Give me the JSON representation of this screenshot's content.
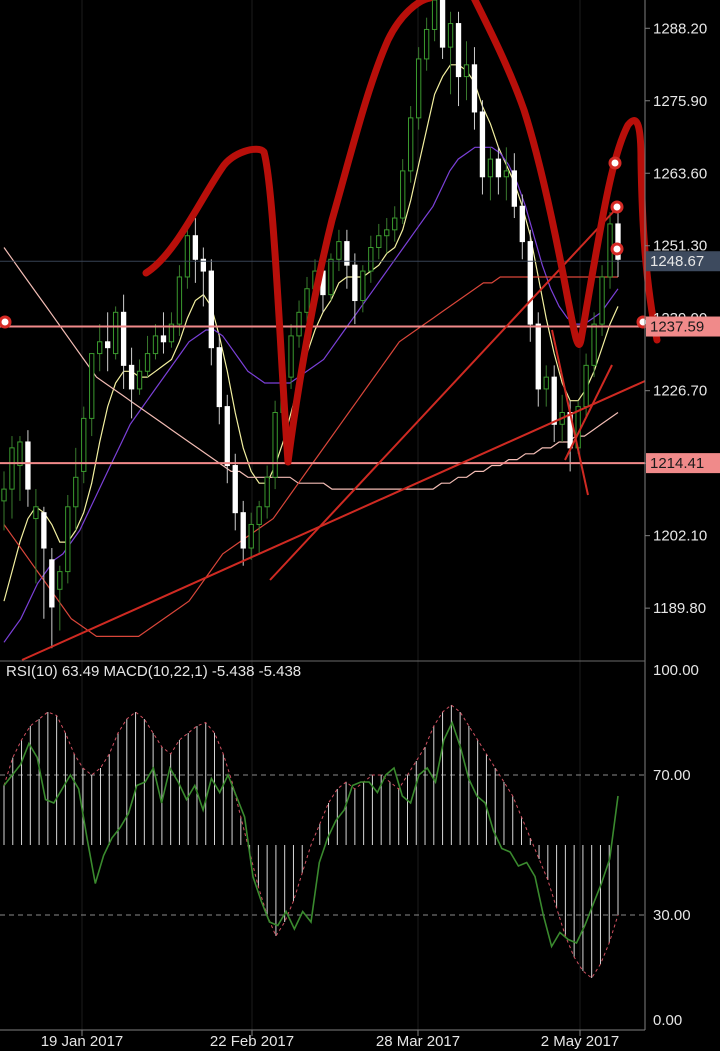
{
  "chart_data": {
    "type": "candlestick",
    "x_ticks": [
      "19 Jan 2017",
      "22 Feb 2017",
      "28 Mar 2017",
      "2 May 2017"
    ],
    "price_axis": {
      "ticks": [
        "1288.20",
        "1275.90",
        "1263.60",
        "1251.30",
        "1239.00",
        "1226.70",
        "1214.40",
        "1202.10",
        "1189.80"
      ],
      "ylim": [
        1181,
        1293
      ]
    },
    "price_tags": [
      {
        "label": "1248.67",
        "value": 1248.67,
        "color": "#3d4a5e"
      },
      {
        "label": "1237.59",
        "value": 1237.59,
        "color": "#f08a8a"
      },
      {
        "label": "1214.41",
        "value": 1214.41,
        "color": "#f08a8a"
      }
    ],
    "candles": [
      {
        "o": 1208,
        "h": 1213,
        "c": 1210,
        "l": 1203
      },
      {
        "o": 1210,
        "h": 1219,
        "c": 1217,
        "l": 1205
      },
      {
        "o": 1214,
        "h": 1219,
        "c": 1218,
        "l": 1208
      },
      {
        "o": 1218,
        "h": 1220,
        "c": 1210,
        "l": 1207
      },
      {
        "o": 1205,
        "h": 1210,
        "c": 1207,
        "l": 1194
      },
      {
        "o": 1206,
        "h": 1207,
        "c": 1200,
        "l": 1188
      },
      {
        "o": 1198,
        "h": 1200,
        "c": 1190,
        "l": 1183
      },
      {
        "o": 1193,
        "h": 1197,
        "c": 1196,
        "l": 1186
      },
      {
        "o": 1196,
        "h": 1209,
        "c": 1207,
        "l": 1194
      },
      {
        "o": 1207,
        "h": 1217,
        "c": 1212,
        "l": 1203
      },
      {
        "o": 1213,
        "h": 1224,
        "c": 1222,
        "l": 1211
      },
      {
        "o": 1222,
        "h": 1232,
        "c": 1233,
        "l": 1219
      },
      {
        "o": 1233,
        "h": 1238,
        "c": 1235,
        "l": 1230
      },
      {
        "o": 1235,
        "h": 1240,
        "c": 1234,
        "l": 1230
      },
      {
        "o": 1233,
        "h": 1241,
        "c": 1240,
        "l": 1232
      },
      {
        "o": 1240,
        "h": 1243,
        "c": 1231,
        "l": 1227
      },
      {
        "o": 1231,
        "h": 1234,
        "c": 1227,
        "l": 1222
      },
      {
        "o": 1227,
        "h": 1232,
        "c": 1230,
        "l": 1226
      },
      {
        "o": 1230,
        "h": 1236,
        "c": 1233,
        "l": 1229
      },
      {
        "o": 1233,
        "h": 1238,
        "c": 1236,
        "l": 1232
      },
      {
        "o": 1236,
        "h": 1240,
        "c": 1235,
        "l": 1233
      },
      {
        "o": 1235,
        "h": 1240,
        "c": 1238,
        "l": 1234
      },
      {
        "o": 1238,
        "h": 1248,
        "c": 1246,
        "l": 1236
      },
      {
        "o": 1246,
        "h": 1255,
        "c": 1253,
        "l": 1244
      },
      {
        "o": 1253,
        "h": 1256,
        "c": 1249,
        "l": 1245
      },
      {
        "o": 1249,
        "h": 1251,
        "c": 1247,
        "l": 1241
      },
      {
        "o": 1247,
        "h": 1249,
        "c": 1234,
        "l": 1231
      },
      {
        "o": 1234,
        "h": 1236,
        "c": 1224,
        "l": 1221
      },
      {
        "o": 1224,
        "h": 1226,
        "c": 1214,
        "l": 1211
      },
      {
        "o": 1214,
        "h": 1216,
        "c": 1206,
        "l": 1203
      },
      {
        "o": 1206,
        "h": 1208,
        "c": 1200,
        "l": 1197
      },
      {
        "o": 1200,
        "h": 1206,
        "c": 1204,
        "l": 1198
      },
      {
        "o": 1204,
        "h": 1208,
        "c": 1207,
        "l": 1199
      },
      {
        "o": 1207,
        "h": 1214,
        "c": 1212,
        "l": 1205
      },
      {
        "o": 1212,
        "h": 1225,
        "c": 1223,
        "l": 1210
      },
      {
        "o": 1223,
        "h": 1231,
        "c": 1229,
        "l": 1221
      },
      {
        "o": 1229,
        "h": 1238,
        "c": 1236,
        "l": 1227
      },
      {
        "o": 1236,
        "h": 1242,
        "c": 1240,
        "l": 1234
      },
      {
        "o": 1240,
        "h": 1246,
        "c": 1244,
        "l": 1238
      },
      {
        "o": 1244,
        "h": 1249,
        "c": 1247,
        "l": 1242
      },
      {
        "o": 1247,
        "h": 1249,
        "c": 1243,
        "l": 1240
      },
      {
        "o": 1243,
        "h": 1250,
        "c": 1249,
        "l": 1242
      },
      {
        "o": 1249,
        "h": 1254,
        "c": 1252,
        "l": 1247
      },
      {
        "o": 1252,
        "h": 1254,
        "c": 1248,
        "l": 1244
      },
      {
        "o": 1248,
        "h": 1250,
        "c": 1242,
        "l": 1238
      },
      {
        "o": 1242,
        "h": 1248,
        "c": 1247,
        "l": 1240
      },
      {
        "o": 1247,
        "h": 1253,
        "c": 1251,
        "l": 1245
      },
      {
        "o": 1251,
        "h": 1255,
        "c": 1253,
        "l": 1249
      },
      {
        "o": 1253,
        "h": 1256,
        "c": 1254,
        "l": 1250
      },
      {
        "o": 1254,
        "h": 1258,
        "c": 1256,
        "l": 1252
      },
      {
        "o": 1256,
        "h": 1266,
        "c": 1264,
        "l": 1255
      },
      {
        "o": 1264,
        "h": 1275,
        "c": 1273,
        "l": 1262
      },
      {
        "o": 1273,
        "h": 1285,
        "c": 1283,
        "l": 1271
      },
      {
        "o": 1283,
        "h": 1290,
        "c": 1288,
        "l": 1281
      },
      {
        "o": 1288,
        "h": 1294,
        "c": 1293,
        "l": 1286
      },
      {
        "o": 1293,
        "h": 1295,
        "c": 1285,
        "l": 1283
      },
      {
        "o": 1285,
        "h": 1291,
        "c": 1289,
        "l": 1277
      },
      {
        "o": 1289,
        "h": 1291,
        "c": 1280,
        "l": 1275
      },
      {
        "o": 1280,
        "h": 1286,
        "c": 1282,
        "l": 1276
      },
      {
        "o": 1282,
        "h": 1285,
        "c": 1274,
        "l": 1271
      },
      {
        "o": 1274,
        "h": 1276,
        "c": 1263,
        "l": 1260
      },
      {
        "o": 1263,
        "h": 1268,
        "c": 1266,
        "l": 1259
      },
      {
        "o": 1266,
        "h": 1268,
        "c": 1263,
        "l": 1260
      },
      {
        "o": 1263,
        "h": 1268,
        "c": 1264,
        "l": 1259
      },
      {
        "o": 1264,
        "h": 1267,
        "c": 1258,
        "l": 1256
      },
      {
        "o": 1258,
        "h": 1260,
        "c": 1252,
        "l": 1249
      },
      {
        "o": 1252,
        "h": 1254,
        "c": 1238,
        "l": 1235
      },
      {
        "o": 1238,
        "h": 1240,
        "c": 1227,
        "l": 1224
      },
      {
        "o": 1227,
        "h": 1231,
        "c": 1229,
        "l": 1224
      },
      {
        "o": 1229,
        "h": 1231,
        "c": 1221,
        "l": 1218
      },
      {
        "o": 1221,
        "h": 1226,
        "c": 1223,
        "l": 1218
      },
      {
        "o": 1223,
        "h": 1225,
        "c": 1217,
        "l": 1213
      },
      {
        "o": 1217,
        "h": 1225,
        "c": 1224,
        "l": 1216
      },
      {
        "o": 1224,
        "h": 1233,
        "c": 1231,
        "l": 1222
      },
      {
        "o": 1231,
        "h": 1240,
        "c": 1238,
        "l": 1229
      },
      {
        "o": 1238,
        "h": 1248,
        "c": 1246,
        "l": 1236
      },
      {
        "o": 1246,
        "h": 1257,
        "c": 1255,
        "l": 1244
      },
      {
        "o": 1255,
        "h": 1258,
        "c": 1249,
        "l": 1246
      }
    ],
    "overlays": [
      {
        "name": "fast",
        "color": "#f3f0a0",
        "values": [
          1191,
          1196,
          1201,
          1205,
          1207,
          1206,
          1204,
          1201,
          1201,
          1203,
          1206,
          1211,
          1218,
          1224,
          1228,
          1230,
          1230,
          1229,
          1229,
          1230,
          1231,
          1232,
          1235,
          1239,
          1242,
          1243,
          1241,
          1236,
          1230,
          1223,
          1217,
          1213,
          1211,
          1211,
          1214,
          1218,
          1223,
          1228,
          1233,
          1237,
          1240,
          1242,
          1245,
          1246,
          1246,
          1246,
          1247,
          1248,
          1250,
          1251,
          1254,
          1259,
          1265,
          1271,
          1277,
          1280,
          1282,
          1282,
          1281,
          1279,
          1275,
          1272,
          1268,
          1265,
          1262,
          1258,
          1253,
          1246,
          1239,
          1233,
          1228,
          1225,
          1225,
          1227,
          1230,
          1234,
          1238,
          1241
        ]
      },
      {
        "name": "medium",
        "color": "#7b40d8",
        "values": [
          1184,
          1186,
          1188,
          1191,
          1194,
          1196,
          1198,
          1199,
          1201,
          1203,
          1206,
          1209,
          1212,
          1215,
          1218,
          1221,
          1223,
          1225,
          1227,
          1229,
          1231,
          1233,
          1235,
          1236,
          1237,
          1237,
          1236,
          1234,
          1232,
          1230,
          1229,
          1228,
          1228,
          1228,
          1228,
          1229,
          1230,
          1231,
          1232,
          1234,
          1236,
          1238,
          1240,
          1242,
          1244,
          1246,
          1248,
          1250,
          1252,
          1254,
          1256,
          1258,
          1261,
          1264,
          1266,
          1267,
          1268,
          1268,
          1268,
          1267,
          1265,
          1262,
          1258,
          1253,
          1248,
          1244,
          1241,
          1239,
          1238,
          1238,
          1239,
          1240,
          1242,
          1244
        ]
      },
      {
        "name": "slow",
        "color": "#f2bcb4",
        "values": [
          1251,
          1249,
          1247,
          1245,
          1243,
          1241,
          1239,
          1237,
          1235,
          1233,
          1231,
          1229,
          1228,
          1227,
          1226,
          1225,
          1224,
          1223,
          1222,
          1221,
          1220,
          1219,
          1218,
          1217,
          1216,
          1215,
          1214,
          1213,
          1213,
          1212,
          1212,
          1212,
          1212,
          1212,
          1212,
          1211,
          1211,
          1211,
          1211,
          1210,
          1210,
          1210,
          1210,
          1210,
          1210,
          1210,
          1210,
          1210,
          1210,
          1210,
          1210,
          1210,
          1211,
          1211,
          1212,
          1212,
          1213,
          1213,
          1214,
          1214,
          1215,
          1215,
          1216,
          1216,
          1217,
          1217,
          1218,
          1218,
          1219,
          1219,
          1220,
          1221,
          1222,
          1223
        ]
      },
      {
        "name": "red",
        "color": "#d9463a",
        "values": [
          1204,
          1202,
          1200,
          1198,
          1196,
          1194,
          1192,
          1190,
          1188,
          1187,
          1186,
          1185,
          1185,
          1185,
          1185,
          1185,
          1185,
          1186,
          1187,
          1188,
          1189,
          1190,
          1191,
          1193,
          1195,
          1197,
          1199,
          1200,
          1201,
          1202,
          1203,
          1204,
          1205,
          1207,
          1209,
          1211,
          1213,
          1215,
          1217,
          1219,
          1221,
          1223,
          1225,
          1227,
          1229,
          1231,
          1233,
          1235,
          1236,
          1237,
          1238,
          1239,
          1240,
          1241,
          1242,
          1243,
          1244,
          1245,
          1245,
          1246,
          1246,
          1246,
          1246,
          1246,
          1246,
          1246,
          1246,
          1246,
          1246,
          1246,
          1246,
          1246,
          1246,
          1246
        ]
      }
    ],
    "indicator": {
      "title": "RSI(10) 63.49 MACD(10,22,1) -5.438 -5.438",
      "ticks": [
        "100.00",
        "70.00",
        "30.00",
        "0.00"
      ],
      "ylim": [
        0,
        100
      ],
      "dashed_levels": [
        70,
        30
      ],
      "histogram_base": 50,
      "rsi": [
        67,
        70,
        73,
        79,
        75,
        63,
        62,
        66,
        70,
        66,
        52,
        39,
        47,
        52,
        55,
        59,
        67,
        68,
        72,
        62,
        72,
        68,
        63,
        67,
        60,
        69,
        65,
        70,
        64,
        58,
        41,
        34,
        28,
        27,
        31,
        26,
        31,
        28,
        45,
        52,
        57,
        60,
        67,
        68,
        68,
        65,
        70,
        72,
        64,
        62,
        70,
        72,
        68,
        80,
        85,
        78,
        69,
        64,
        62,
        54,
        49,
        48,
        44,
        45,
        41,
        30,
        21,
        25,
        23,
        22,
        27,
        33,
        39,
        46,
        64
      ],
      "histogram": [
        67,
        75,
        80,
        84,
        86,
        88,
        87,
        82,
        76,
        72,
        70,
        72,
        76,
        82,
        86,
        88,
        86,
        82,
        78,
        76,
        80,
        82,
        84,
        85,
        82,
        76,
        68,
        58,
        48,
        38,
        30,
        24,
        28,
        34,
        42,
        50,
        56,
        62,
        66,
        68,
        66,
        68,
        70,
        70,
        68,
        66,
        70,
        74,
        78,
        84,
        88,
        90,
        88,
        84,
        80,
        76,
        72,
        68,
        64,
        58,
        52,
        46,
        40,
        32,
        24,
        18,
        14,
        12,
        16,
        22,
        30
      ]
    }
  }
}
